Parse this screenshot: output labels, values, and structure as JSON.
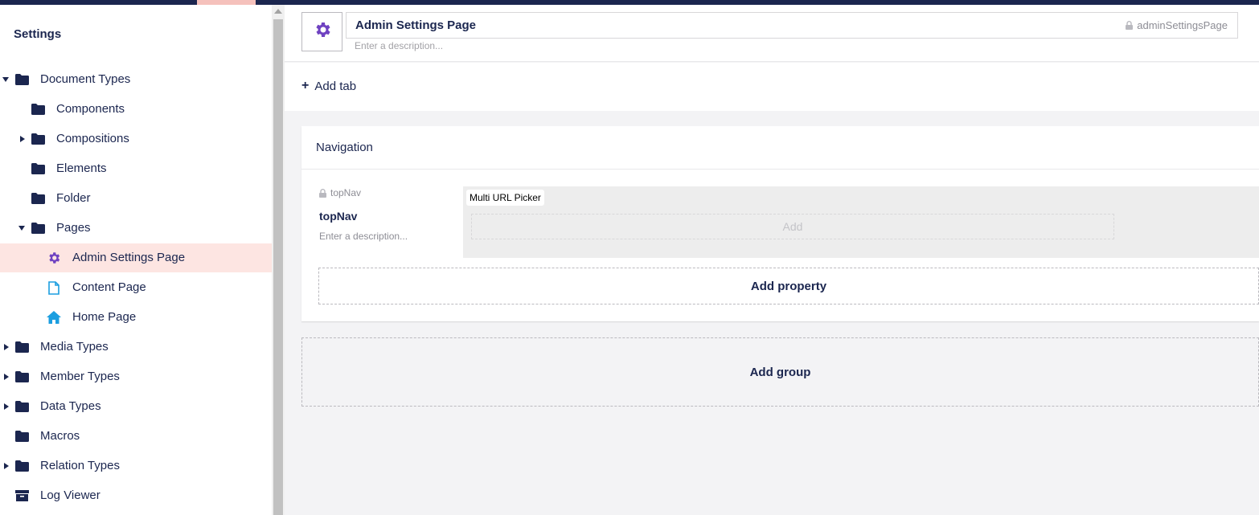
{
  "sidebar": {
    "title": "Settings",
    "items": [
      {
        "label": "Document Types",
        "icon": "folder-icon",
        "expand": "down"
      },
      {
        "label": "Components",
        "icon": "folder-icon",
        "expand": "none"
      },
      {
        "label": "Compositions",
        "icon": "folder-icon",
        "expand": "right"
      },
      {
        "label": "Elements",
        "icon": "folder-icon",
        "expand": "none"
      },
      {
        "label": "Folder",
        "icon": "folder-icon",
        "expand": "none"
      },
      {
        "label": "Pages",
        "icon": "folder-icon",
        "expand": "down"
      },
      {
        "label": "Admin Settings Page",
        "icon": "gear-icon",
        "expand": "none",
        "selected": true
      },
      {
        "label": "Content Page",
        "icon": "document-icon",
        "expand": "none"
      },
      {
        "label": "Home Page",
        "icon": "home-icon",
        "expand": "none"
      },
      {
        "label": "Media Types",
        "icon": "folder-icon",
        "expand": "right"
      },
      {
        "label": "Member Types",
        "icon": "folder-icon",
        "expand": "right"
      },
      {
        "label": "Data Types",
        "icon": "folder-icon",
        "expand": "right"
      },
      {
        "label": "Macros",
        "icon": "folder-icon",
        "expand": "none"
      },
      {
        "label": "Relation Types",
        "icon": "folder-icon",
        "expand": "right"
      },
      {
        "label": "Log Viewer",
        "icon": "box-icon",
        "expand": "none"
      }
    ]
  },
  "header": {
    "name": "Admin Settings Page",
    "alias": "adminSettingsPage",
    "description_placeholder": "Enter a description...",
    "icon": "gear-icon"
  },
  "tabs": {
    "add_tab_label": "Add tab"
  },
  "group": {
    "name": "Navigation",
    "property": {
      "alias": "topNav",
      "name": "topNav",
      "description_placeholder": "Enter a description...",
      "editor_label": "Multi URL Picker",
      "editor_add_label": "Add"
    },
    "add_property_label": "Add property"
  },
  "add_group_label": "Add group",
  "colors": {
    "navy": "#1b264f",
    "selected_bg": "#fde5e2",
    "purple": "#6f42c1",
    "blue": "#1b9ee0"
  }
}
